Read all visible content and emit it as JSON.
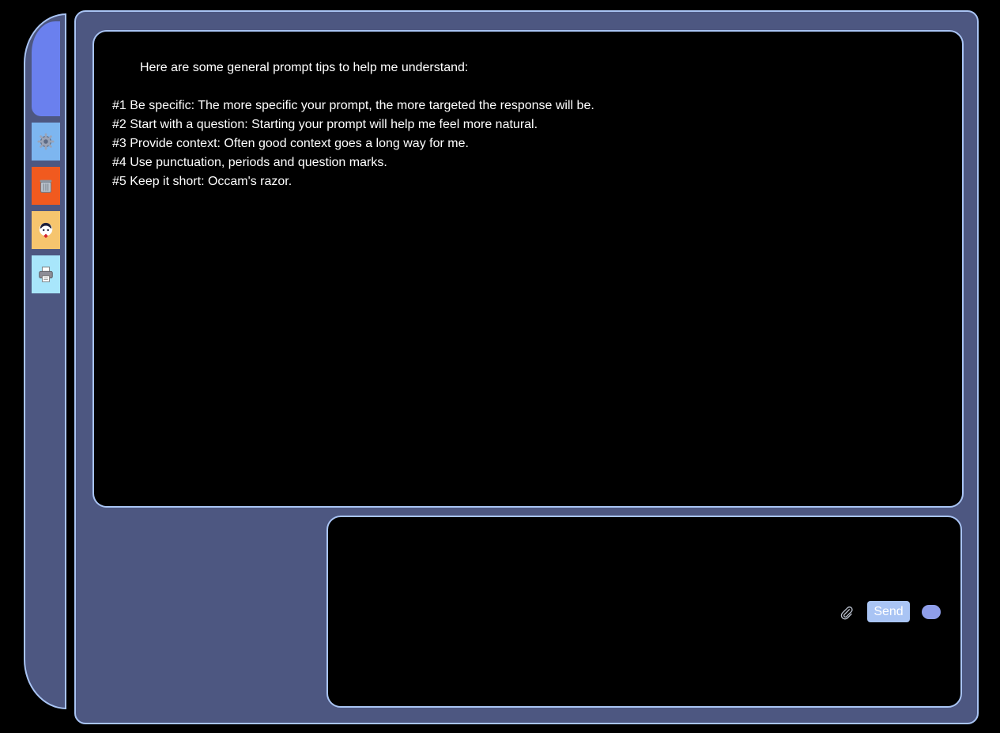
{
  "sidebar": {
    "buttons": [
      {
        "name": "settings",
        "icon": "gear-icon",
        "color": "#7db6f0"
      },
      {
        "name": "clear",
        "icon": "trash-icon",
        "color": "#f15a1f"
      },
      {
        "name": "avatar",
        "icon": "avatar-icon",
        "color": "#f6c56e"
      },
      {
        "name": "print",
        "icon": "printer-icon",
        "color": "#a8e6fb"
      }
    ]
  },
  "output": {
    "intro": "Here are some general prompt tips to help me understand:",
    "tips": [
      "#1 Be specific: The more specific your prompt, the more targeted the response will be.",
      "#2 Start with a question: Starting your prompt will help me feel more natural.",
      "#3 Provide context: Often good context goes a long way for me.",
      "#4 Use punctuation, periods and question marks.",
      "#5 Keep it short: Occam's razor."
    ]
  },
  "input": {
    "value": "",
    "placeholder": "",
    "attach_icon": "paperclip-icon",
    "send_label": "Send",
    "toggle_icon": "toggle-icon"
  },
  "colors": {
    "frame": "#4d5781",
    "border": "#a9c4f4",
    "accent": "#6a80ee",
    "send_button": "#a9c4f4"
  }
}
